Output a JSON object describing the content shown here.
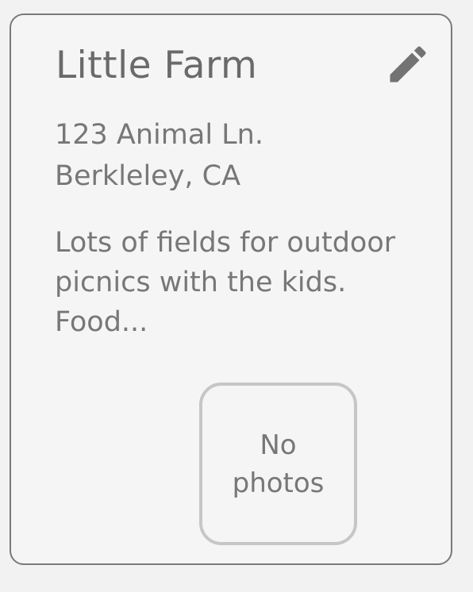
{
  "card": {
    "title": "Little Farm",
    "address": {
      "line1": "123 Animal Ln.",
      "line2": "Berkleley, CA"
    },
    "description": "Lots of fields for outdoor picnics with the kids. Food...",
    "photos_placeholder": "No photos",
    "edit_icon": "pencil-icon"
  },
  "colors": {
    "text": "#777777",
    "title": "#6a6a6a",
    "card_border": "#7a7a7a",
    "photo_border": "#c6c6c6",
    "background": "#f5f5f5"
  }
}
